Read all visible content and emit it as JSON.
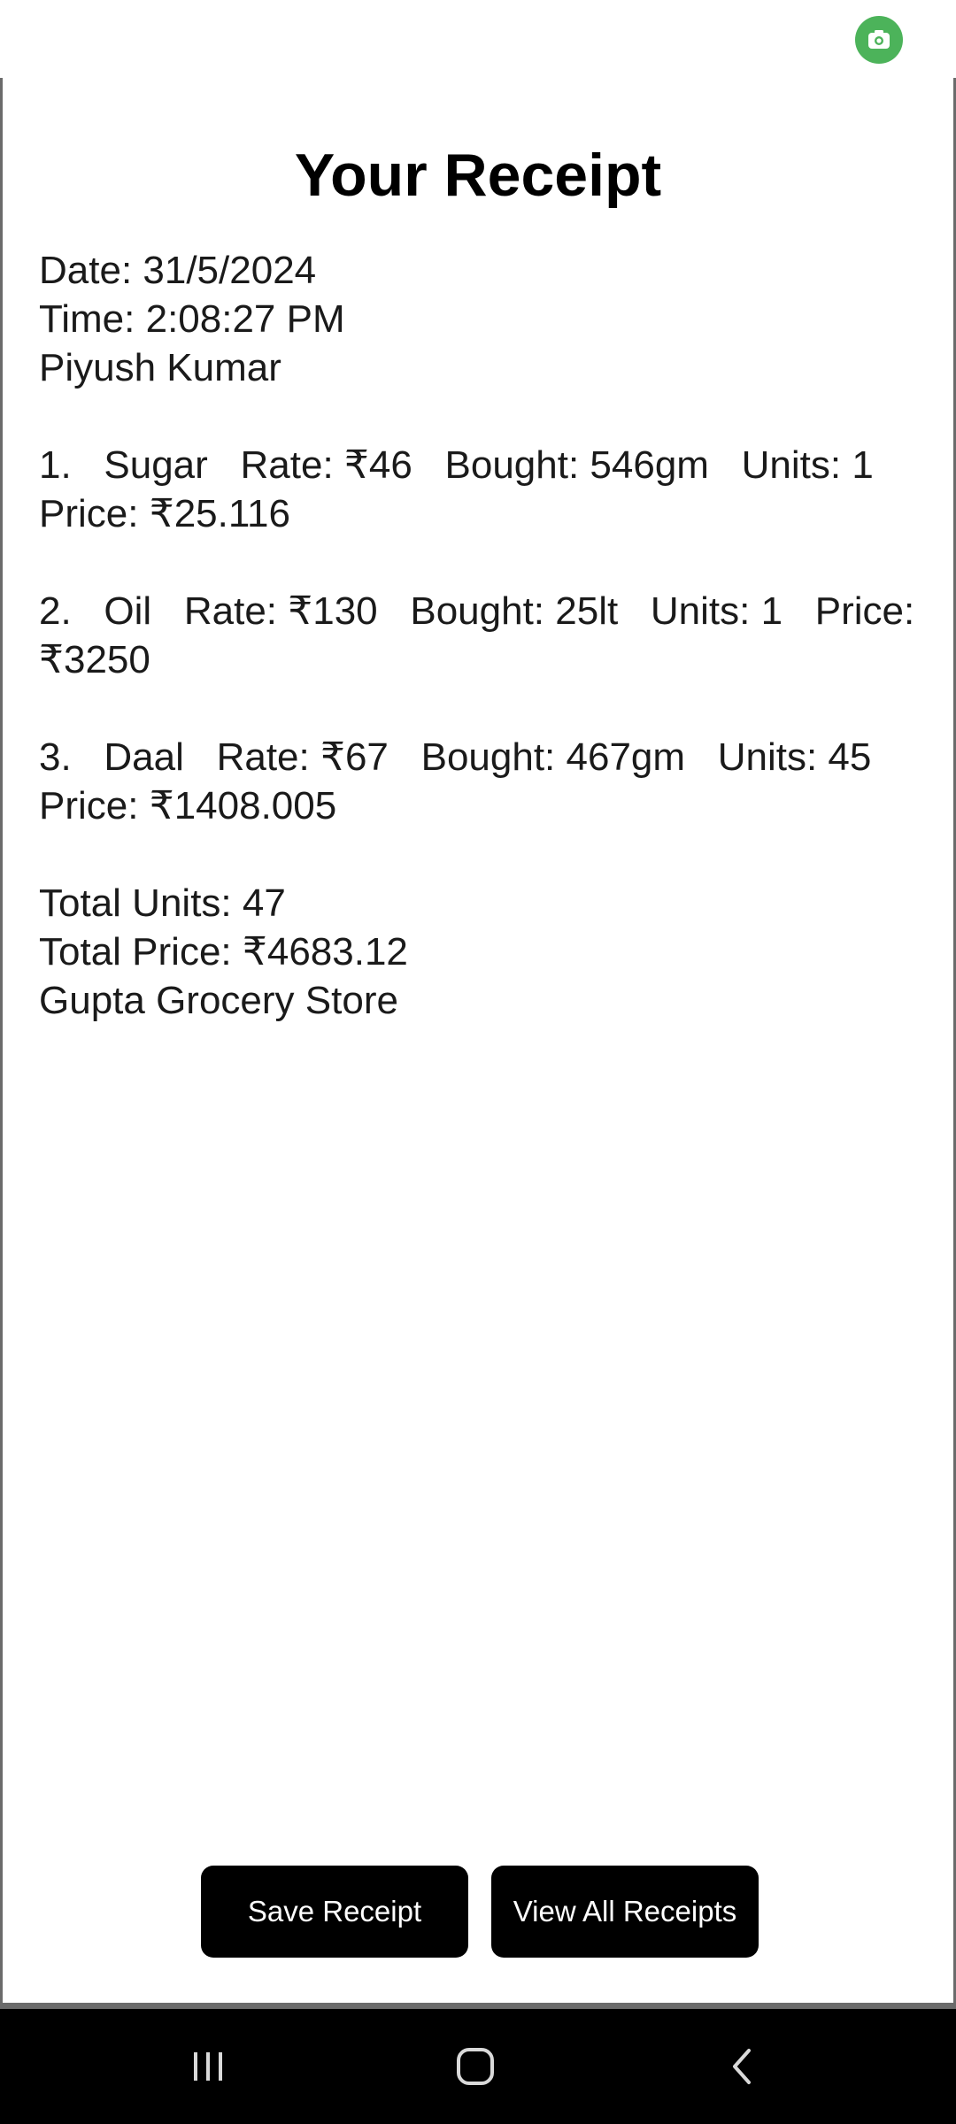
{
  "status_bar": {
    "indicator_icon": "camera-icon",
    "indicator_color": "#4cb35a"
  },
  "receipt": {
    "title": "Your Receipt",
    "date_line": "Date: 31/5/2024",
    "time_line": "Time: 2:08:27 PM",
    "customer": "Piyush Kumar",
    "items": [
      {
        "number": "1.",
        "name": "Sugar",
        "rate": "Rate: ₹46",
        "bought": "Bought: 546gm",
        "units": "Units: 1",
        "price": "Price: ₹25.116"
      },
      {
        "number": "2.",
        "name": "Oil",
        "rate": "Rate: ₹130",
        "bought": "Bought: 25lt",
        "units": "Units: 1",
        "price": "Price:",
        "price_value": "₹3250"
      },
      {
        "number": "3.",
        "name": "Daal",
        "rate": "Rate: ₹67",
        "bought": "Bought: 467gm",
        "units": "Units: 45",
        "price": "Price: ₹1408.005"
      }
    ],
    "total_units": "Total Units: 47",
    "total_price": "Total Price: ₹4683.12",
    "store": "Gupta Grocery Store"
  },
  "actions": {
    "save_label": "Save Receipt",
    "view_all_label": "View All Receipts"
  },
  "nav": {
    "recents_icon": "recents-icon",
    "home_icon": "home-icon",
    "back_icon": "back-icon"
  },
  "colors": {
    "button_bg": "#000000",
    "button_text": "#ffffff",
    "nav_bg": "#000000"
  }
}
